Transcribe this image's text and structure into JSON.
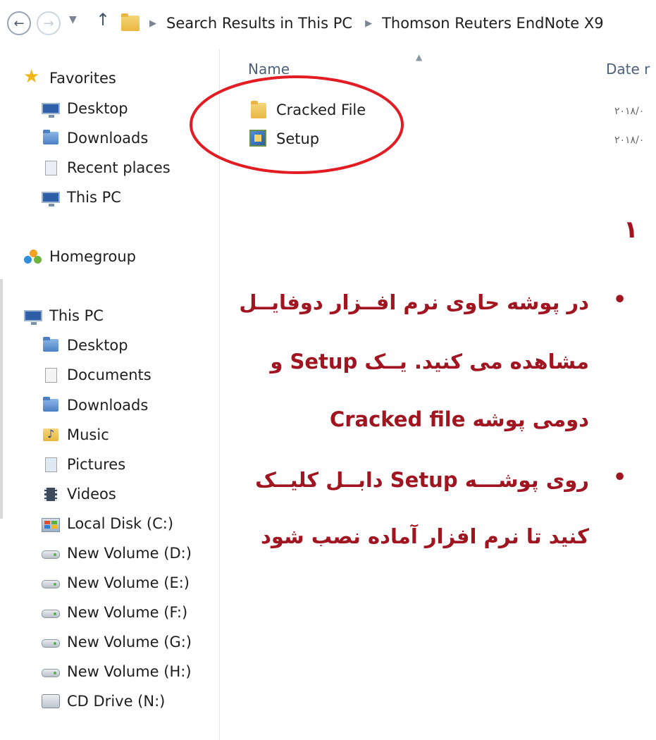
{
  "address_bar": {
    "breadcrumbs": [
      "Search Results in This PC",
      "Thomson Reuters EndNote X9"
    ]
  },
  "nav_pane": {
    "favorites": {
      "header": "Favorites",
      "items": [
        "Desktop",
        "Downloads",
        "Recent places",
        "This PC"
      ]
    },
    "homegroup": "Homegroup",
    "this_pc": {
      "header": "This PC",
      "items": [
        "Desktop",
        "Documents",
        "Downloads",
        "Music",
        "Pictures",
        "Videos",
        "Local Disk (C:)",
        "New Volume (D:)",
        "New Volume (E:)",
        "New Volume (F:)",
        "New Volume (G:)",
        "New Volume (H:)",
        "CD Drive (N:)"
      ]
    }
  },
  "file_list": {
    "col_name": "Name",
    "col_date": "Date r",
    "files": [
      {
        "name": "Cracked File",
        "date": "۲۰۱۸/۰",
        "icon": "folder-icon"
      },
      {
        "name": "Setup",
        "date": "۲۰۱۸/۰",
        "icon": "setup-icon"
      }
    ]
  },
  "annotation": {
    "number": "۱",
    "bullet1_lines": [
      "در پوشه حاوی نرم افــزار دوفایــل",
      "مشاهده می کنید. یــک Setup و",
      "دومی پوشه Cracked file"
    ],
    "bullet2_lines": [
      "روی پوشـــه Setup دابــل کلیــک",
      "کنید تا نرم افزار آماده نصب شود"
    ],
    "highlight_color": "#e31b23",
    "text_color": "#a01520"
  }
}
